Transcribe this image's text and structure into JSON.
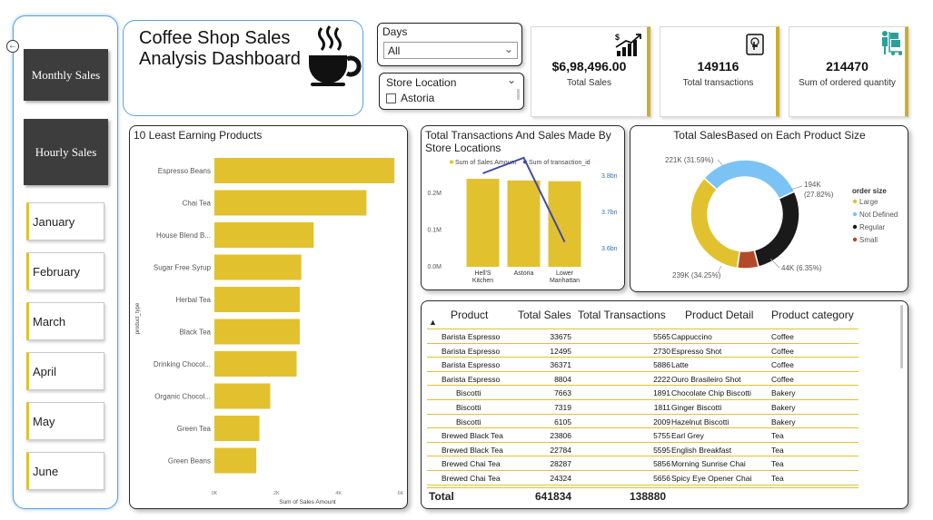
{
  "sidebar": {
    "nav": [
      {
        "label": "Monthly Sales"
      },
      {
        "label": "Hourly Sales"
      }
    ],
    "months": [
      {
        "label": "January"
      },
      {
        "label": "February"
      },
      {
        "label": "March"
      },
      {
        "label": "April"
      },
      {
        "label": "May"
      },
      {
        "label": "June"
      }
    ]
  },
  "header": {
    "title_line1": "Coffee Shop Sales",
    "title_line2": "Analysis Dashboard"
  },
  "slicers": {
    "days_label": "Days",
    "days_value": "All",
    "store_label": "Store Location",
    "store_option": "Astoria"
  },
  "kpis": [
    {
      "value": "$6,98,496.00",
      "label": "Total Sales",
      "icon": "money-growth-icon"
    },
    {
      "value": "149116",
      "label": "Total transactions",
      "icon": "touch-screen-icon"
    },
    {
      "value": "214470",
      "label": "Sum of ordered quantity",
      "icon": "delivery-person-icon"
    }
  ],
  "colors": {
    "accent": "#e2c12f",
    "line": "#3f4aa8",
    "not_defined": "#7cc3f5",
    "regular": "#1a1a1a",
    "small": "#b54a2a",
    "sidebar_border": "#5aa0e0"
  },
  "least_earning": {
    "title": "10 Least Earning Products",
    "ylabel": "product_type",
    "xlabel": "Sum of Sales Amount"
  },
  "store_chart": {
    "title_line1": "Total Transactions And Sales Made By",
    "title_line2": "Store Locations",
    "legend1": "Sum of Sales Amount",
    "legend2": "Sum of transaction_id"
  },
  "size_chart": {
    "title": "Total SalesBased on Each Product Size",
    "legend_title": "order size",
    "label_not_defined": "221K (31.59%)",
    "label_regular_1": "194K",
    "label_regular_2": "(27.82%)",
    "label_small": "44K (6.35%)",
    "label_large": "239K (34.25%)"
  },
  "chart_data": [
    {
      "type": "bar",
      "title": "10 Least Earning Products",
      "ylabel": "product_type",
      "xlabel": "Sum of Sales Amount",
      "orientation": "horizontal",
      "categories": [
        "Espresso Beans",
        "Chai Tea",
        "House Blend B...",
        "Sugar Free Syrup",
        "Herbal Tea",
        "Black Tea",
        "Drinking Chocol...",
        "Organic Chocol...",
        "Green Tea",
        "Green Beans"
      ],
      "values": [
        5800,
        4900,
        3200,
        2800,
        2750,
        2750,
        2650,
        1800,
        1450,
        1350
      ],
      "xticks": [
        "0K",
        "2K",
        "4K",
        "6K"
      ],
      "xlim": [
        0,
        6000
      ]
    },
    {
      "type": "bar",
      "title": "Total Transactions And Sales Made By Store Locations",
      "categories": [
        "Hell'S Kitchen",
        "Astoria",
        "Lower Manhattan"
      ],
      "series": [
        {
          "name": "Sum of Sales Amount",
          "type": "bar",
          "values": [
            236500,
            232000,
            230000
          ],
          "axis": "left"
        },
        {
          "name": "Sum of transaction_id",
          "type": "line",
          "values": [
            38000000000.0,
            38500000000.0,
            35800000000.0
          ],
          "axis": "right"
        }
      ],
      "yticks_left": [
        "0.0M",
        "0.1M",
        "0.2M"
      ],
      "ylim_left": [
        0,
        300000
      ],
      "yticks_right": [
        "3.6bn",
        "3.7bn",
        "3.8bn"
      ],
      "ylim_right": [
        35000000000.0,
        38000000000.0
      ]
    },
    {
      "type": "pie",
      "title": "Total SalesBased on Each Product Size",
      "donut": true,
      "legend_title": "order size",
      "legend_position": "right",
      "labels": [
        "Large",
        "Not Defined",
        "Regular",
        "Small"
      ],
      "values": [
        239,
        221,
        194,
        44
      ],
      "percent": [
        34.25,
        31.59,
        27.82,
        6.35
      ]
    }
  ],
  "table": {
    "headers": [
      "Product",
      "Total Sales",
      "Total Transactions",
      "Product Detail",
      "Product category"
    ],
    "rows": [
      [
        "Barista Espresso",
        "33675",
        "5565",
        "Cappuccino",
        "Coffee"
      ],
      [
        "Barista Espresso",
        "12495",
        "2730",
        "Espresso Shot",
        "Coffee"
      ],
      [
        "Barista Espresso",
        "36371",
        "5886",
        "Latte",
        "Coffee"
      ],
      [
        "Barista Espresso",
        "8804",
        "2222",
        "Ouro Brasileiro Shot",
        "Coffee"
      ],
      [
        "Biscotti",
        "7663",
        "1891",
        "Chocolate Chip Biscotti",
        "Bakery"
      ],
      [
        "Biscotti",
        "7319",
        "1811",
        "Ginger Biscotti",
        "Bakery"
      ],
      [
        "Biscotti",
        "6105",
        "2009",
        "Hazelnut Biscotti",
        "Bakery"
      ],
      [
        "Brewed Black Tea",
        "23806",
        "5755",
        "Earl Grey",
        "Tea"
      ],
      [
        "Brewed Black Tea",
        "22784",
        "5595",
        "English Breakfast",
        "Tea"
      ],
      [
        "Brewed Chai Tea",
        "28287",
        "5856",
        "Morning Sunrise Chai",
        "Tea"
      ],
      [
        "Brewed Chai Tea",
        "24324",
        "5656",
        "Spicy Eye Opener Chai",
        "Tea"
      ]
    ],
    "total_label": "Total",
    "total_sales": "641834",
    "total_transactions": "138880"
  }
}
